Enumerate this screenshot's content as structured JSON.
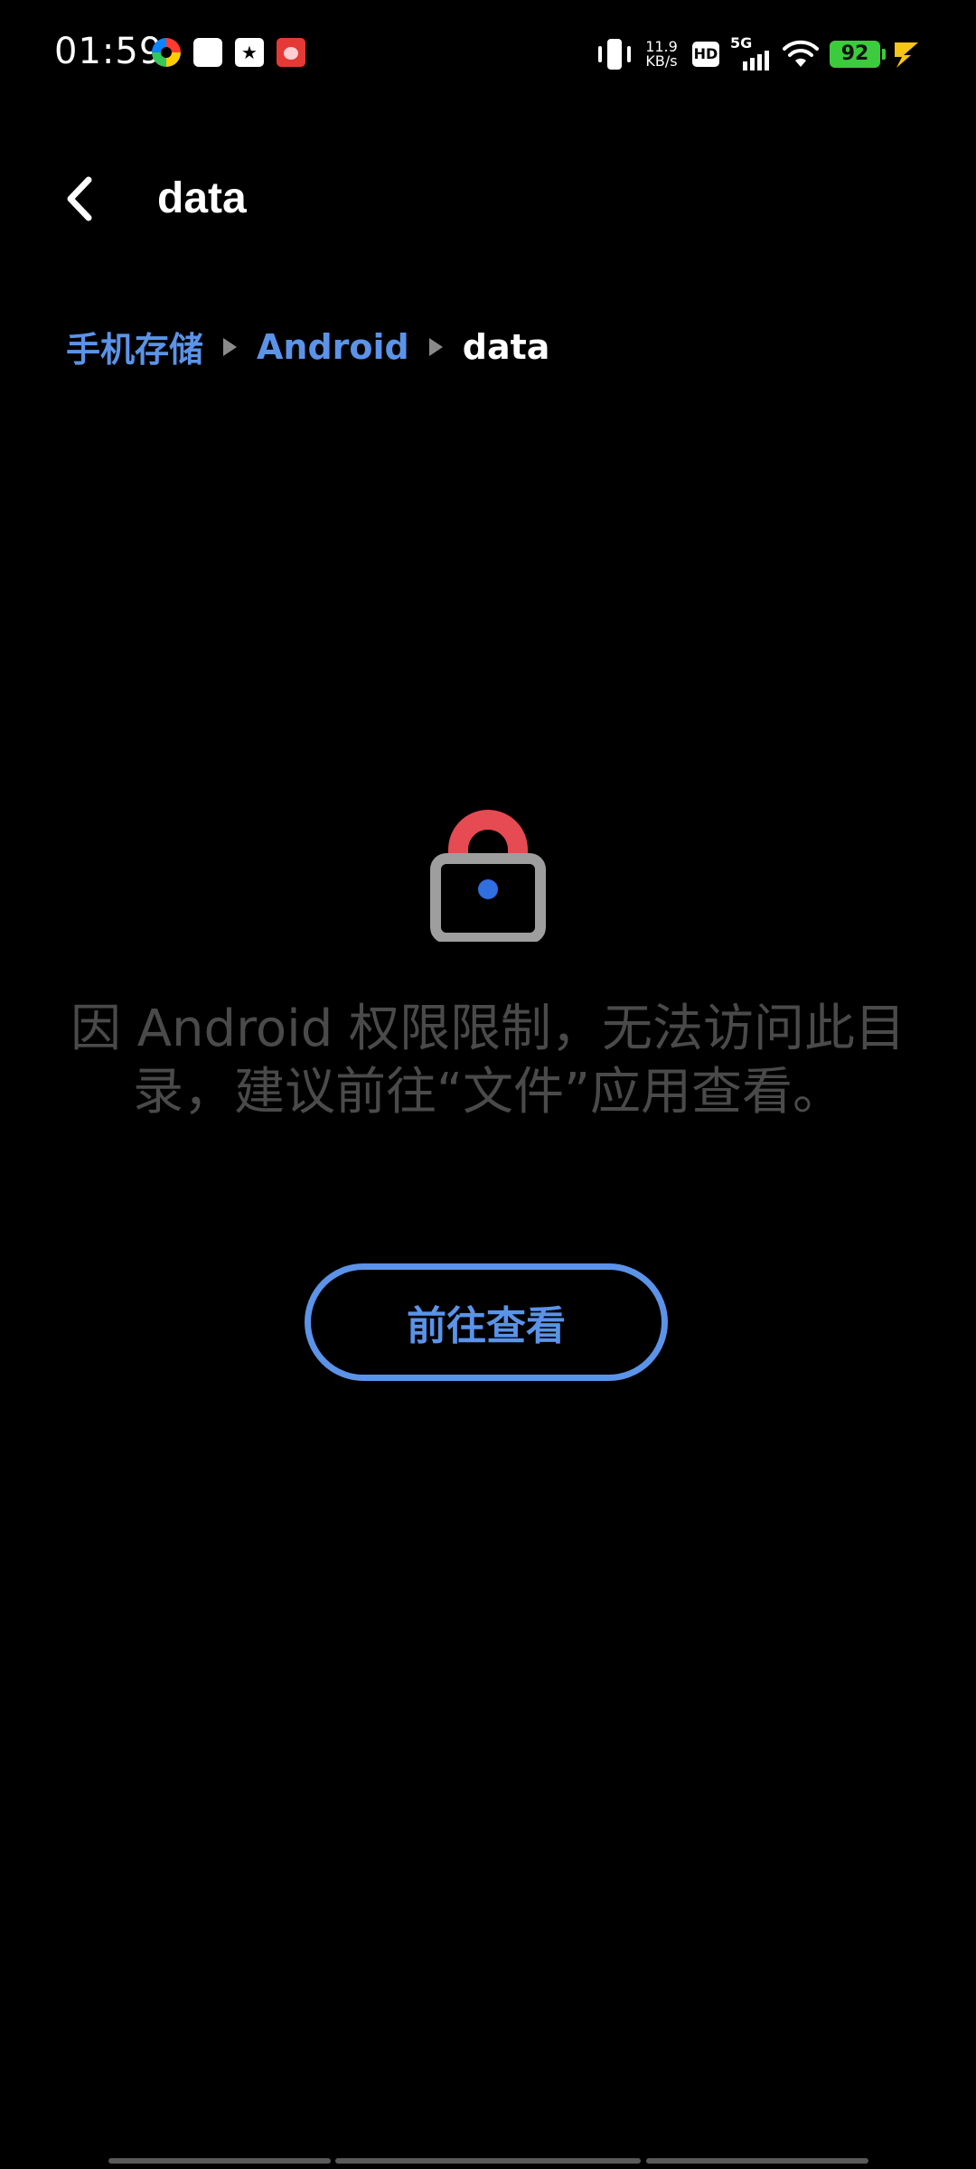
{
  "status_bar": {
    "time": "01:59",
    "net_speed_value": "11.9",
    "net_speed_unit": "KB/s",
    "hd_label": "HD",
    "network_label": "5G",
    "battery_level": "92",
    "battery_color": "#3ccb3c",
    "notification_icons": [
      "colorful-app-icon",
      "white-square-icon",
      "star-message-icon",
      "red-app-icon"
    ]
  },
  "header": {
    "title": "data"
  },
  "breadcrumb": {
    "items": [
      {
        "label": "手机存储"
      },
      {
        "label": "Android"
      },
      {
        "label": "data"
      }
    ]
  },
  "main": {
    "lock_icon": "lock-icon",
    "message": "因 Android 权限限制，无法访问此目录，建议前往“文件”应用查看。",
    "button_label": "前往查看"
  },
  "colors": {
    "accent": "#5b93e8",
    "lock_shackle": "#e64a52",
    "lock_body": "#9e9e9e",
    "lock_dot": "#2f6fe0",
    "message_text": "#4a4a4a"
  }
}
